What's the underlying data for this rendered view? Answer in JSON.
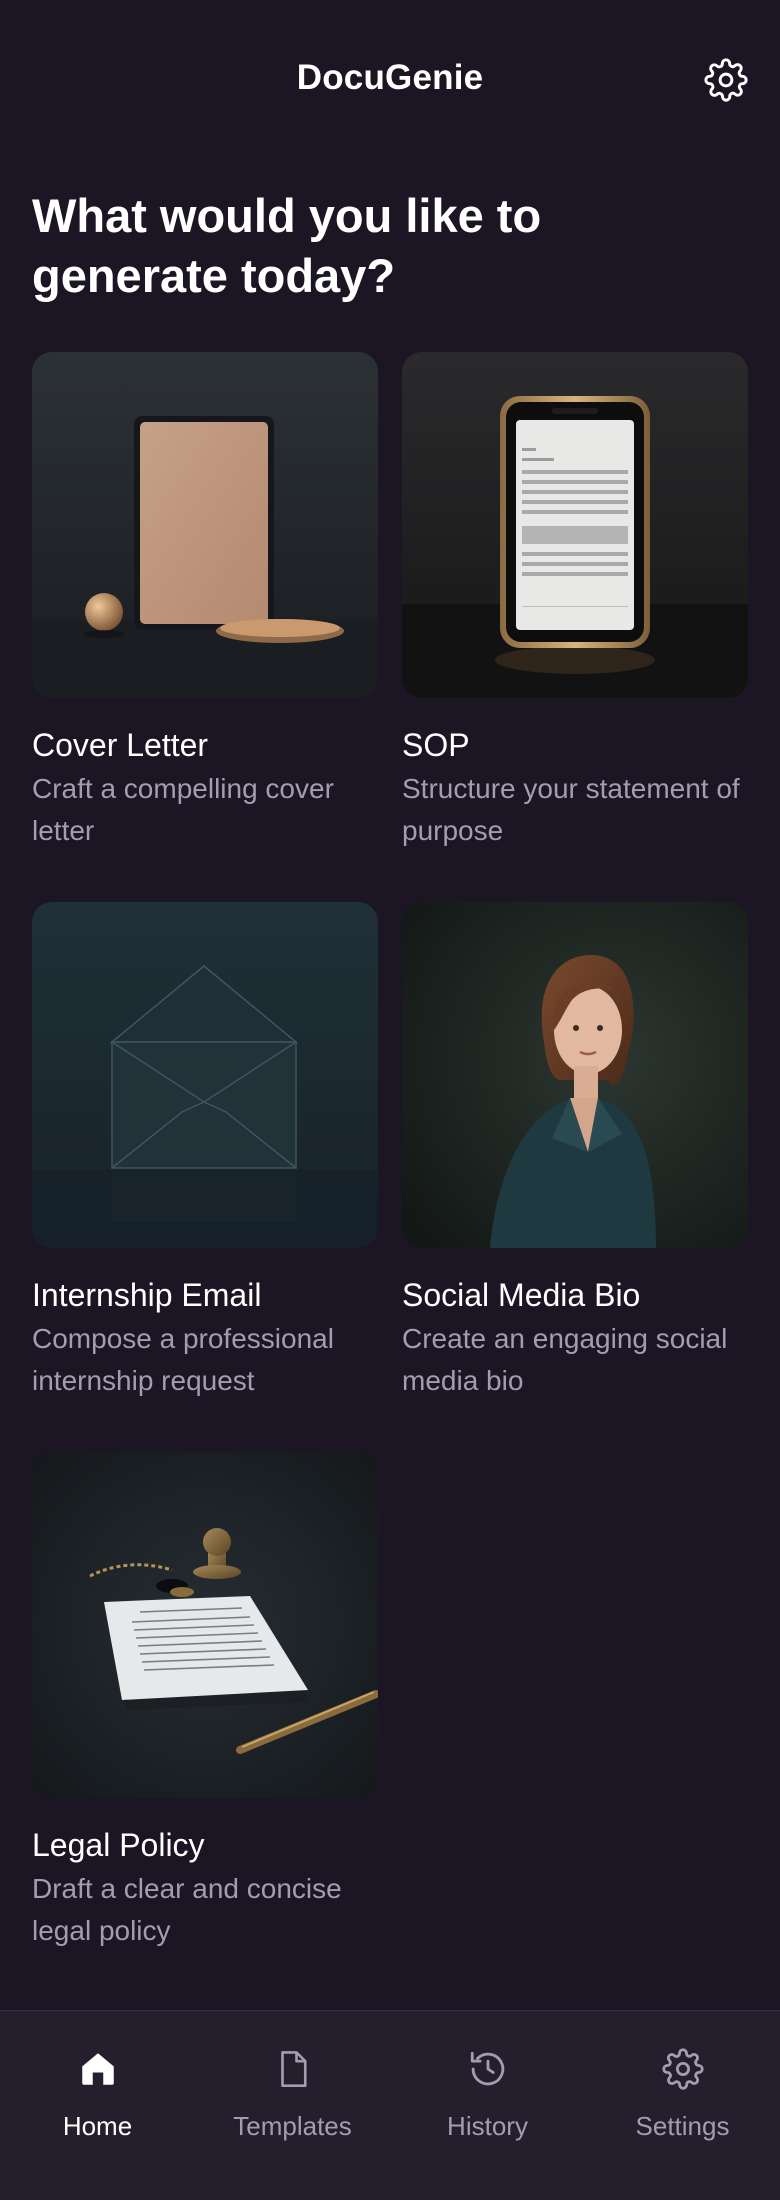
{
  "app": {
    "title": "DocuGenie"
  },
  "header": {
    "settings_icon": "gear-icon"
  },
  "headline": "What would you like to generate today?",
  "cards": [
    {
      "title": "Cover Letter",
      "description": "Craft a compelling cover letter",
      "image": "tablet-with-brass-ball-and-tray"
    },
    {
      "title": "SOP",
      "description": "Structure your statement of purpose",
      "image": "gold-phone-with-document"
    },
    {
      "title": "Internship Email",
      "description": "Compose a professional internship request",
      "image": "dark-envelope"
    },
    {
      "title": "Social Media Bio",
      "description": "Create an engaging social media bio",
      "image": "woman-portrait-dark-blazer"
    },
    {
      "title": "Legal Policy",
      "description": "Draft a clear and concise legal policy",
      "image": "document-with-stamp-and-pen"
    }
  ],
  "nav": {
    "items": [
      {
        "label": "Home",
        "icon": "home-icon",
        "active": true
      },
      {
        "label": "Templates",
        "icon": "document-icon",
        "active": false
      },
      {
        "label": "History",
        "icon": "history-icon",
        "active": false
      },
      {
        "label": "Settings",
        "icon": "gear-icon",
        "active": false
      }
    ]
  },
  "colors": {
    "background": "#1c1624",
    "nav_background": "#241e2d",
    "muted_text": "#a49cb0",
    "primary_text": "#ffffff"
  }
}
